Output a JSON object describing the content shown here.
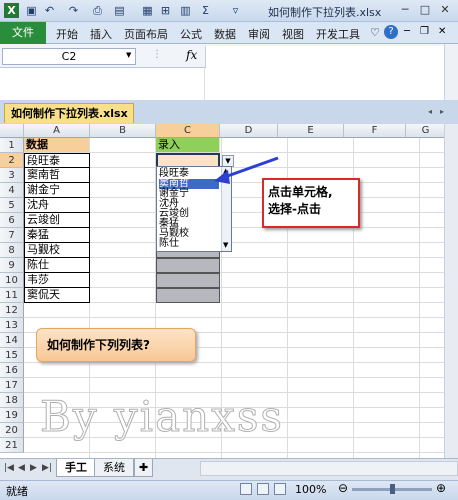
{
  "window": {
    "title": "如何制作下拉列表.xlsx",
    "minimize": "─",
    "maximize": "□",
    "close": "✕"
  },
  "quick_access": [
    "save-icon",
    "undo-icon",
    "redo-icon",
    "print-icon"
  ],
  "ribbon": {
    "file_tab": "文件",
    "tabs": [
      "开始",
      "插入",
      "页面布局",
      "公式",
      "数据",
      "审阅",
      "视图",
      "开发工具"
    ]
  },
  "formula_bar": {
    "name_box": "C2",
    "fx_label": "fx",
    "value": ""
  },
  "workbook_tab": "如何制作下拉列表.xlsx",
  "columns": [
    "A",
    "B",
    "C",
    "D",
    "E",
    "F",
    "G"
  ],
  "rows": [
    "1",
    "2",
    "3",
    "4",
    "5",
    "6",
    "7",
    "8",
    "9",
    "10",
    "11",
    "12",
    "13",
    "14",
    "15",
    "16",
    "17",
    "18",
    "19",
    "20",
    "21"
  ],
  "cells": {
    "A1": "数据",
    "A2": "段旺泰",
    "A3": "窦南哲",
    "A4": "谢金宁",
    "A5": "沈舟",
    "A6": "云竣创",
    "A7": "秦猛",
    "A8": "马觐校",
    "A9": "陈仕",
    "A10": "韦莎",
    "A11": "窦侃天",
    "C1": "录入"
  },
  "dropdown": {
    "items": [
      "段旺泰",
      "窦南哲",
      "谢金宁",
      "沈舟",
      "云竣创",
      "秦猛",
      "马觐校",
      "陈仕"
    ],
    "highlighted_index": 1
  },
  "callouts": {
    "instruction": "点击单元格,\n选择-点击",
    "question": "如何制作下列列表?"
  },
  "watermark": "By yianxss",
  "sheet_tabs": [
    "手工",
    "系统"
  ],
  "status": {
    "mode": "就绪",
    "zoom": "100%"
  },
  "colors": {
    "header_fill": "#f6cf9a",
    "input_col_fill": "#b7b7c0",
    "c1_fill": "#8fd05a",
    "file_tab": "#2a8d3b",
    "callout_border": "#d62b2b"
  }
}
